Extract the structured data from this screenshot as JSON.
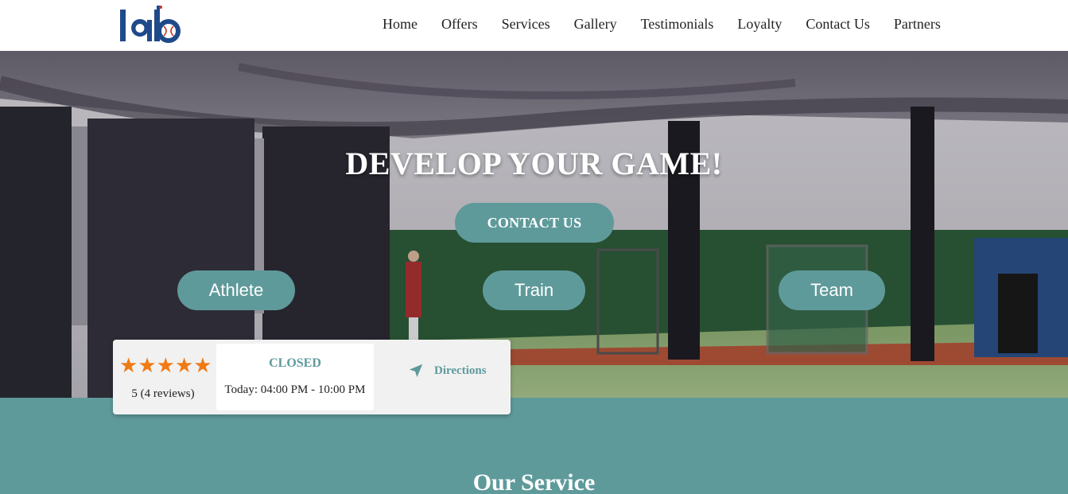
{
  "header": {
    "logo_text": "lab",
    "nav": [
      "Home",
      "Offers",
      "Services",
      "Gallery",
      "Testimonials",
      "Loyalty",
      "Contact Us",
      "Partners"
    ]
  },
  "hero": {
    "title": "DEVELOP YOUR GAME!",
    "contact_button": "CONTACT US",
    "pills": {
      "athlete": "Athlete",
      "train": "Train",
      "team": "Team"
    }
  },
  "info_card": {
    "rating_stars": 5,
    "reviews_text": "5 (4 reviews)",
    "status": "CLOSED",
    "hours": "Today: 04:00 PM - 10:00 PM",
    "directions": "Directions"
  },
  "section": {
    "title": "Our Service"
  },
  "colors": {
    "accent": "#5f9a9b",
    "star": "#f07a14",
    "logo_blue": "#1f4a8a",
    "logo_red": "#c0392b"
  },
  "icons": [
    "logo-icon",
    "star-icon",
    "navigation-arrow-icon"
  ]
}
